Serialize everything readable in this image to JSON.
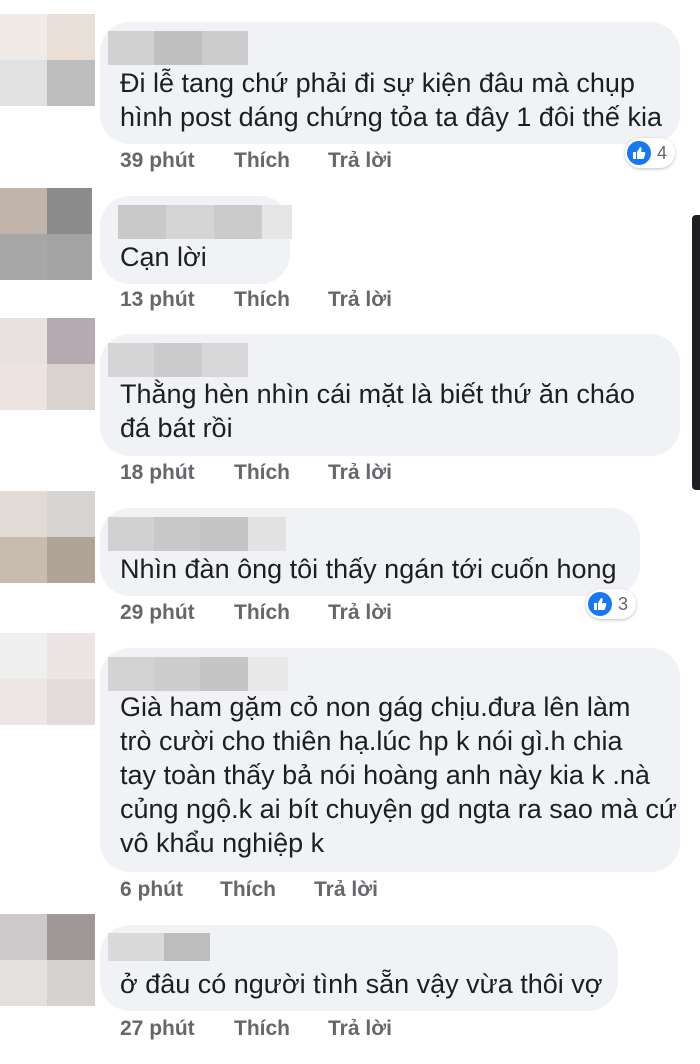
{
  "comments": [
    {
      "text": "Đi lễ tang chứ phải đi sự kiện đâu mà chụp\nhình post dáng chứng tỏa ta đây 1 đôi thế kia",
      "time": "39 phút",
      "like_label": "Thích",
      "reply_label": "Trả lời",
      "reaction_count": "4",
      "reaction_icon": "like-icon",
      "avatar_colors": [
        "#f1ebe7",
        "#e9dfd6",
        "#e1e1e1",
        "#bdbdbd"
      ],
      "name_colors": [
        "#d1d1d1",
        "#c0c0c0",
        "#cdcdcd"
      ]
    },
    {
      "text": "Cạn lời",
      "time": "13 phút",
      "like_label": "Thích",
      "reply_label": "Trả lời",
      "reaction_count": null,
      "avatar_colors": [
        "#c1b5ab",
        "#8c8c8c",
        "#a7a7a7",
        "#a4a4a4"
      ],
      "name_colors": [
        "#c9c9c9",
        "#d4d4d4",
        "#cbcbcb",
        "#e6e6e6"
      ]
    },
    {
      "text": "Thằng hèn nhìn cái mặt là biết thứ ăn cháo\nđá bát rồi",
      "time": "18 phút",
      "like_label": "Thích",
      "reply_label": "Trả lời",
      "reaction_count": null,
      "avatar_colors": [
        "#e7e1e0",
        "#b4aab0",
        "#ede4e1",
        "#d9d2cd"
      ],
      "name_colors": [
        "#d5d5d5",
        "#cbcbcb",
        "#d7d7d7"
      ]
    },
    {
      "text": "Nhìn đàn ông tôi thấy ngán tới cuốn hong",
      "time": "29 phút",
      "like_label": "Thích",
      "reply_label": "Trả lời",
      "reaction_count": "3",
      "reaction_icon": "like-icon",
      "avatar_colors": [
        "#e2dad5",
        "#d7d3d0",
        "#c8bcae",
        "#b0a496"
      ],
      "name_colors": [
        "#d1d1d1",
        "#c8c8c8",
        "#c4c4c4",
        "#e2e2e2"
      ]
    },
    {
      "text": "Già ham gặm cỏ non gág chịu.đưa lên làm\ntrò cười cho thiên hạ.lúc hp k nói gì.h chia\ntay toàn thấy bả nói hoàng anh này kia k .nà\ncủng ngộ.k ai bít chuyện gd ngta ra sao mà cứ\nvô khẩu nghiệp k",
      "time": "6 phút",
      "like_label": "Thích",
      "reply_label": "Trả lời",
      "reaction_count": null,
      "avatar_colors": [
        "#efefef",
        "#ebe5e5",
        "#ece7e4",
        "#e2dddc"
      ],
      "name_colors": [
        "#d3d3d3",
        "#cdcdcd",
        "#c5c5c5",
        "#e8e8e8"
      ]
    },
    {
      "text": "ở đâu có người tình sẵn vậy vừa thôi vợ",
      "time": "27 phút",
      "like_label": "Thích",
      "reply_label": "Trả lời",
      "reaction_count": null,
      "avatar_colors": [
        "#cbc9c9",
        "#9f9896",
        "#e3e1e0",
        "#d6d2d0"
      ],
      "name_colors": [
        "#dadada",
        "#bdbdbd"
      ]
    }
  ],
  "colors": {
    "bubble": "#f0f2f5",
    "action_text": "#65676b",
    "like_blue": "#1877f2"
  }
}
